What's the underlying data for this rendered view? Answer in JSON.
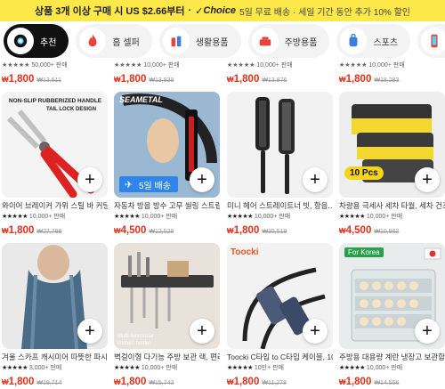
{
  "promo": {
    "main": "상품 3개 이상 구매 시 US $2.66부터",
    "sep": "·",
    "check": "✓",
    "choice": "Choice",
    "sub": "5일 무료 배송 · 세일 기간 동안 추가 10% 할인"
  },
  "categories": [
    {
      "label": "추천",
      "icon": "sparkle-icon",
      "active": true
    },
    {
      "label": "홈 셀퍼",
      "icon": "fire-icon",
      "active": false
    },
    {
      "label": "생활용품",
      "icon": "bottles-icon",
      "active": false
    },
    {
      "label": "주방용품",
      "icon": "pot-icon",
      "active": false
    },
    {
      "label": "스포츠",
      "icon": "backpack-icon",
      "active": false
    },
    {
      "label": "디지",
      "icon": "phone-icon",
      "active": false
    }
  ],
  "partial_row": [
    {
      "meta": "★★★★★ 50,000+ 판매",
      "cur": "₩",
      "price": "1,800",
      "old": "₩13,611"
    },
    {
      "meta": "★★★★★ 10,000+ 판매",
      "cur": "₩",
      "price": "1,800",
      "old": "₩13,938"
    },
    {
      "meta": "★★★★★ 10,000+ 판매",
      "cur": "₩",
      "price": "1,800",
      "old": "₩13,976"
    },
    {
      "meta": "★★★★★ 10,000+ 판매",
      "cur": "₩",
      "price": "1,800",
      "old": "₩18,283"
    }
  ],
  "products": [
    {
      "title": "와이어 브레이커 가위 스틸 바 커팅 ...",
      "stars": "★★★★★",
      "sold": "10,000+ 판매",
      "cur": "₩",
      "price": "1,800",
      "old": "₩27,788",
      "badge_10": "",
      "ship": "",
      "korea": "",
      "image_text": "NON-SLIP RUBBERIZED HANDLE TAIL LOCK DESIGN"
    },
    {
      "title": "자동차 방음 방수 고무 씰링 스트립, ...",
      "stars": "★★★★★",
      "sold": "10,000+ 판매",
      "cur": "₩",
      "price": "4,500",
      "old": "₩12,528",
      "badge_10": "",
      "ship": "5일 배송",
      "korea": "",
      "image_text": "SEAMETAL"
    },
    {
      "title": "미니 헤어 스트레이트너 빗, 항음...",
      "stars": "★★★★★",
      "sold": "10,000+ 판매",
      "cur": "₩",
      "price": "1,800",
      "old": "₩35,519",
      "badge_10": "",
      "ship": "",
      "korea": "",
      "image_text": ""
    },
    {
      "title": "차량용 극세사 세차 타월, 세차 건조...",
      "stars": "★★★★★",
      "sold": "10,000+ 판매",
      "cur": "₩",
      "price": "4,500",
      "old": "₩10,962",
      "badge_10": "10 Pcs",
      "ship": "",
      "korea": "",
      "image_text": ""
    },
    {
      "title": "겨울 스카프 캐시미어 따뜻한 파시미...",
      "stars": "★★★★★",
      "sold": "3,000+ 판매",
      "cur": "₩",
      "price": "1,800",
      "old": "₩19,714",
      "badge_10": "",
      "ship": "",
      "korea": "",
      "image_text": ""
    },
    {
      "title": "벽걸이형 다기능 주방 보관 랙, 편리...",
      "stars": "★★★★★",
      "sold": "10,000+ 판매",
      "cur": "₩",
      "price": "1,800",
      "old": "₩15,743",
      "badge_10": "",
      "ship": "",
      "korea": "",
      "image_text": "Multi-functional kitchen holder"
    },
    {
      "title": "Toocki C타입 to C타입 케이블, 100...",
      "stars": "★★★★★",
      "sold": "10만+ 판매",
      "cur": "₩",
      "price": "1,800",
      "old": "₩11,278",
      "badge_10": "",
      "ship": "",
      "korea": "",
      "image_text": "Toocki"
    },
    {
      "title": "주방용 대용량 계란 냉장고 보관함...",
      "stars": "★★★★★",
      "sold": "10,000+ 판매",
      "cur": "₩",
      "price": "1,800",
      "old": "₩14,556",
      "badge_10": "",
      "ship": "",
      "korea": "For Korea",
      "image_text": ""
    }
  ],
  "plus_label": "+",
  "colors": {
    "promo_bg": "#fde84a",
    "price": "#e0311a",
    "ship_badge": "#2f86e8"
  }
}
